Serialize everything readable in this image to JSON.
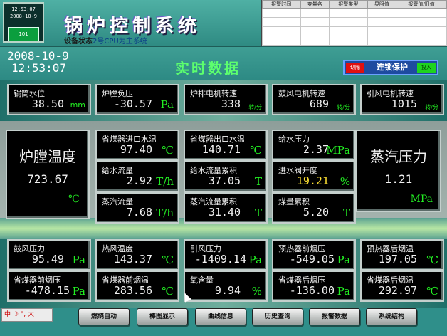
{
  "header": {
    "clock_time": "12:53:07",
    "clock_date": "2008-10-9",
    "cpu_label": "101",
    "title": "锅炉控制系统",
    "device_status_label": "设备状态",
    "device_status_value": "2号CPU为主系统"
  },
  "alarm_table": {
    "columns": [
      "报警时间",
      "变量名",
      "报警类型",
      "界限值",
      "报警值/旧值"
    ],
    "rows": 4
  },
  "datetime": {
    "date": "2008-10-9",
    "time": "12:53:07"
  },
  "realtime_title": "实时数据",
  "interlock": {
    "left_label": "切除",
    "center_label": "连锁保护",
    "right_label": "投入"
  },
  "row1": [
    {
      "label": "锅筒水位",
      "value": "38.50",
      "unit": "mm"
    },
    {
      "label": "炉膛负压",
      "value": "-30.57",
      "unit": "Pa"
    },
    {
      "label": "炉排电机转速",
      "value": "338",
      "unit": "转/分"
    },
    {
      "label": "鼓风电机转速",
      "value": "689",
      "unit": "转/分"
    },
    {
      "label": "引风电机转速",
      "value": "1015",
      "unit": "转/分"
    }
  ],
  "furnace_temp": {
    "label": "炉膛温度",
    "value": "723.67",
    "unit": "℃"
  },
  "steam_pressure": {
    "label": "蒸汽压力",
    "value": "1.21",
    "unit": "MPa"
  },
  "mid_grid": [
    {
      "label": "省煤器进口水温",
      "value": "97.40",
      "unit": "℃"
    },
    {
      "label": "省煤器出口水温",
      "value": "140.71",
      "unit": "℃"
    },
    {
      "label": "给水压力",
      "value": "2.37",
      "unit": "MPa"
    },
    {
      "label": "给水流量",
      "value": "2.92",
      "unit": "T/h"
    },
    {
      "label": "给水流量累积",
      "value": "37.05",
      "unit": "T"
    },
    {
      "label": "进水阀开度",
      "value": "19.21",
      "unit": "%"
    },
    {
      "label": "蒸汽流量",
      "value": "7.68",
      "unit": "T/h"
    },
    {
      "label": "蒸汽流量累积",
      "value": "31.40",
      "unit": "T"
    },
    {
      "label": "煤量累积",
      "value": "5.20",
      "unit": "T"
    }
  ],
  "row4": [
    {
      "label": "鼓风压力",
      "value": "95.49",
      "unit": "Pa"
    },
    {
      "label": "热风温度",
      "value": "143.37",
      "unit": "℃"
    },
    {
      "label": "引风压力",
      "value": "-1409.14",
      "unit": "Pa"
    },
    {
      "label": "预热器前烟压",
      "value": "-549.05",
      "unit": "Pa"
    },
    {
      "label": "预热器后烟温",
      "value": "197.05",
      "unit": "℃"
    }
  ],
  "row5": [
    {
      "label": "省煤器前烟压",
      "value": "-478.15",
      "unit": "Pa"
    },
    {
      "label": "省煤器前烟温",
      "value": "283.56",
      "unit": "℃"
    },
    {
      "label": "氧含量",
      "value": "9.94",
      "unit": "%"
    },
    {
      "label": "省煤器后烟压",
      "value": "-136.00",
      "unit": "Pa"
    },
    {
      "label": "省煤器后烟温",
      "value": "292.97",
      "unit": "℃"
    }
  ],
  "ime_label": "中 ☽ °, 大",
  "nav": [
    "燃烧自动",
    "棒图显示",
    "曲线信息",
    "历史查询",
    "报警数据",
    "系统结构"
  ],
  "colors": {
    "value_green": "#22ee22",
    "highlight_yellow": "#ffe233",
    "title_green": "#5cff6e"
  }
}
